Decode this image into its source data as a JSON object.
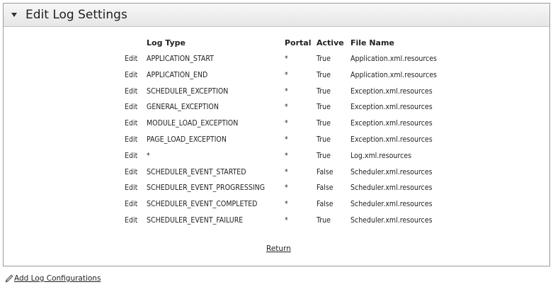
{
  "panel": {
    "title": "Edit Log Settings"
  },
  "table": {
    "headers": {
      "log_type": "Log Type",
      "portal": "Portal",
      "active": "Active",
      "file_name": "File Name"
    },
    "rows": [
      {
        "edit": "Edit",
        "log_type": "APPLICATION_START",
        "portal": "*",
        "active": "True",
        "file_name": "Application.xml.resources"
      },
      {
        "edit": "Edit",
        "log_type": "APPLICATION_END",
        "portal": "*",
        "active": "True",
        "file_name": "Application.xml.resources"
      },
      {
        "edit": "Edit",
        "log_type": "SCHEDULER_EXCEPTION",
        "portal": "*",
        "active": "True",
        "file_name": "Exception.xml.resources"
      },
      {
        "edit": "Edit",
        "log_type": "GENERAL_EXCEPTION",
        "portal": "*",
        "active": "True",
        "file_name": "Exception.xml.resources"
      },
      {
        "edit": "Edit",
        "log_type": "MODULE_LOAD_EXCEPTION",
        "portal": "*",
        "active": "True",
        "file_name": "Exception.xml.resources"
      },
      {
        "edit": "Edit",
        "log_type": "PAGE_LOAD_EXCEPTION",
        "portal": "*",
        "active": "True",
        "file_name": "Exception.xml.resources"
      },
      {
        "edit": "Edit",
        "log_type": "*",
        "portal": "*",
        "active": "True",
        "file_name": "Log.xml.resources"
      },
      {
        "edit": "Edit",
        "log_type": "SCHEDULER_EVENT_STARTED",
        "portal": "*",
        "active": "False",
        "file_name": "Scheduler.xml.resources"
      },
      {
        "edit": "Edit",
        "log_type": "SCHEDULER_EVENT_PROGRESSING",
        "portal": "*",
        "active": "False",
        "file_name": "Scheduler.xml.resources"
      },
      {
        "edit": "Edit",
        "log_type": "SCHEDULER_EVENT_COMPLETED",
        "portal": "*",
        "active": "False",
        "file_name": "Scheduler.xml.resources"
      },
      {
        "edit": "Edit",
        "log_type": "SCHEDULER_EVENT_FAILURE",
        "portal": "*",
        "active": "True",
        "file_name": "Scheduler.xml.resources"
      }
    ]
  },
  "actions": {
    "return_label": "Return",
    "add_config_label": "Add Log Configurations",
    "add_config_icon": "pencil-icon",
    "toggle_icon": "collapse-triangle-icon"
  }
}
